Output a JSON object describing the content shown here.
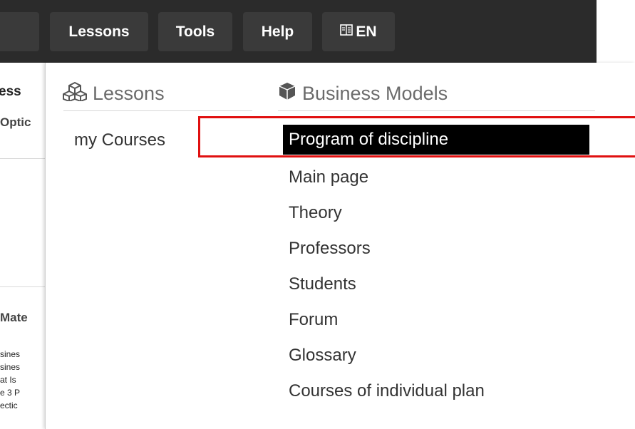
{
  "navbar": {
    "items": [
      {
        "label": "Lessons"
      },
      {
        "label": "Tools"
      },
      {
        "label": "Help"
      },
      {
        "label": "EN",
        "icon": "globe-book-icon"
      }
    ]
  },
  "background": {
    "fragments": [
      "ess",
      "Optic",
      "Mate",
      "sines",
      "sines",
      "at Is",
      "e 3 P",
      "ectic"
    ]
  },
  "dropdown": {
    "lessons": {
      "heading": "Lessons",
      "icon": "cubes-icon",
      "links": [
        "my Courses"
      ]
    },
    "business_models": {
      "heading": "Business Models",
      "icon": "cube-icon",
      "links": [
        "Program of discipline",
        "Main page",
        "Theory",
        "Professors",
        "Students",
        "Forum",
        "Glossary",
        "Courses of individual plan"
      ],
      "active_index": 0
    }
  },
  "annotation": {
    "highlight_color": "#e01010"
  }
}
